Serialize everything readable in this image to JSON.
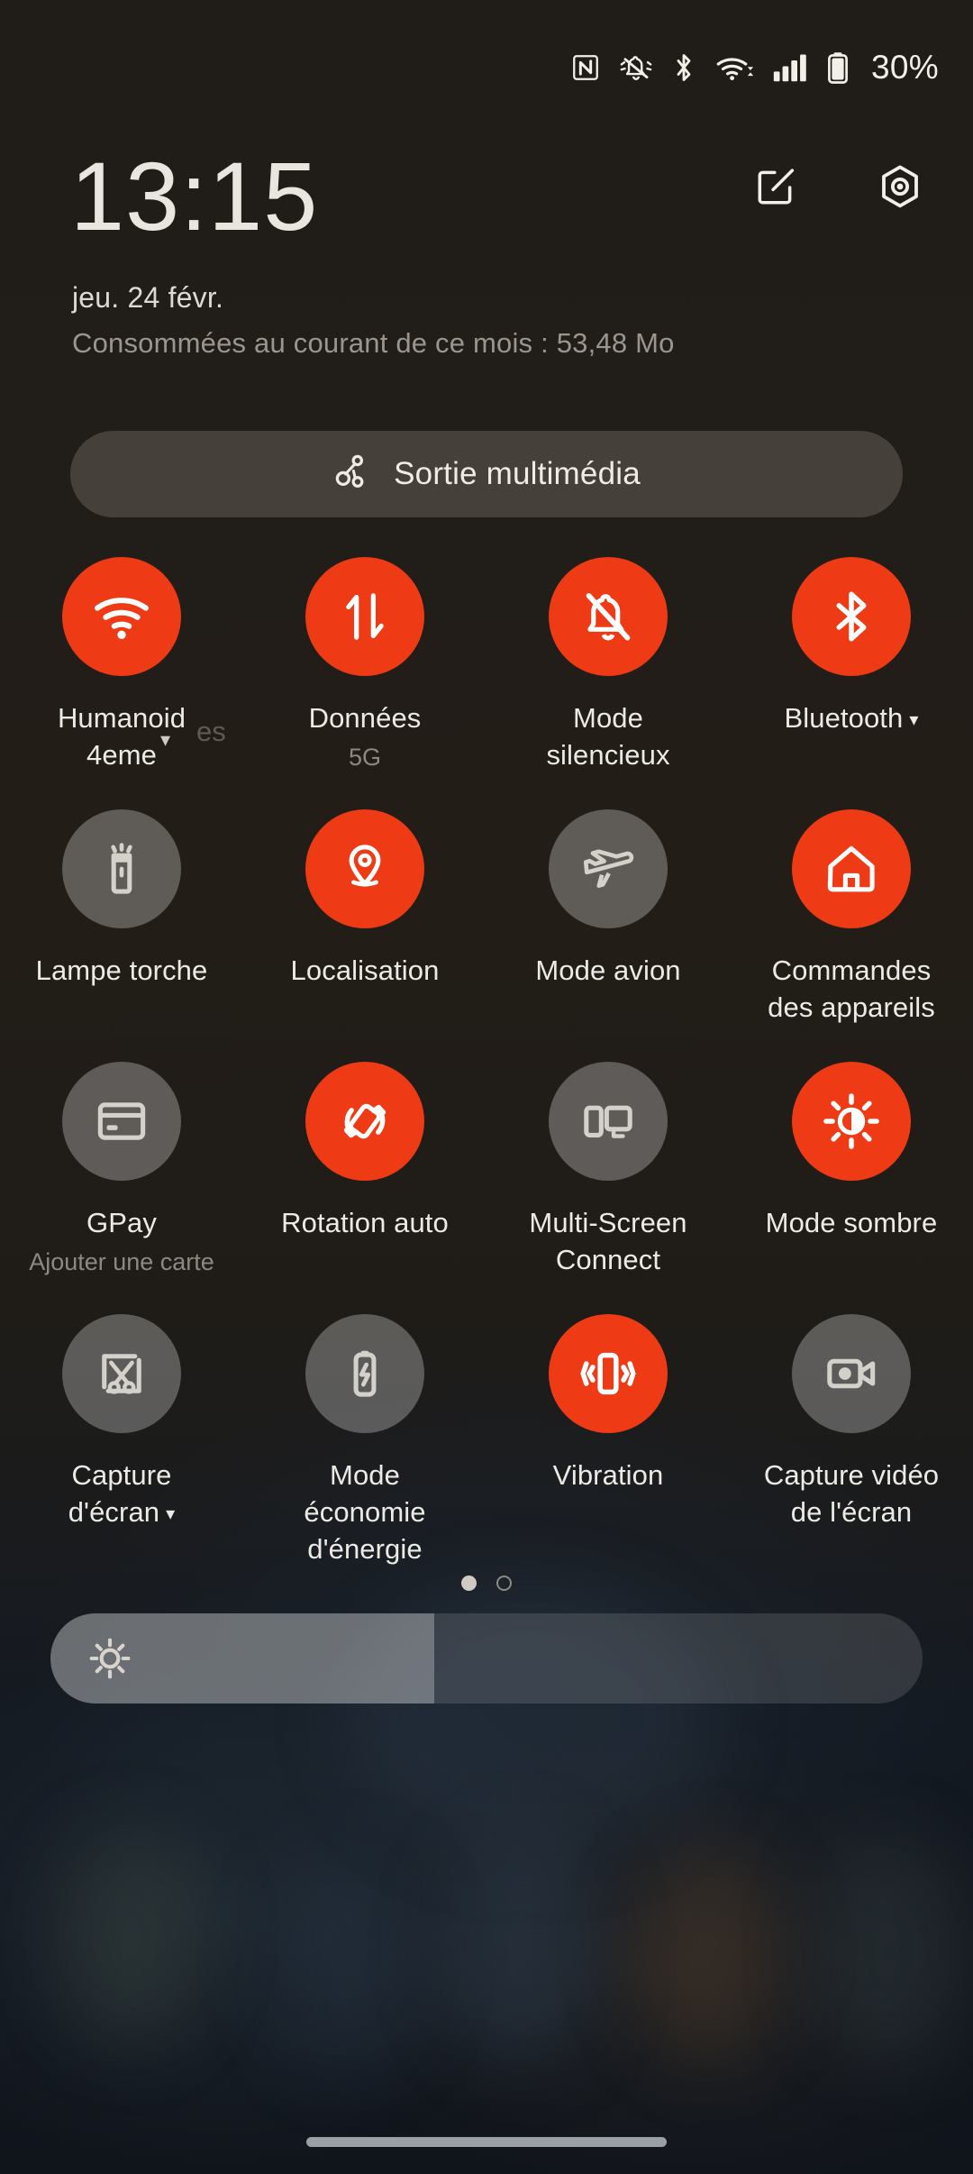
{
  "statusbar": {
    "battery_percent": "30%",
    "icons": [
      "nfc-icon",
      "bell-muted-icon",
      "bluetooth-icon",
      "wifi-icon",
      "signal-bars-icon",
      "battery-icon"
    ]
  },
  "header": {
    "clock": "13:15",
    "date": "jeu. 24 févr.",
    "data_usage": "Consommées au courant de ce mois : 53,48 Mo",
    "edit_icon": "edit-pencil-icon",
    "settings_icon": "settings-hexagon-icon"
  },
  "media_output": {
    "label": "Sortie multimédia",
    "icon": "media-cast-icon"
  },
  "tiles": [
    {
      "label": "Humanoid 4eme",
      "sub": "",
      "state": "on",
      "icon": "wifi-icon",
      "caret": false,
      "float_caret": true,
      "ghost": "es"
    },
    {
      "label": "Données",
      "sub": "5G",
      "state": "on",
      "icon": "data-arrows-icon",
      "caret": false,
      "float_caret": false,
      "ghost": ""
    },
    {
      "label": "Mode silencieux",
      "sub": "",
      "state": "on",
      "icon": "bell-muted-icon",
      "caret": false,
      "float_caret": false,
      "ghost": ""
    },
    {
      "label": "Bluetooth",
      "sub": "",
      "state": "on",
      "icon": "bluetooth-icon",
      "caret": true,
      "float_caret": false,
      "ghost": ""
    },
    {
      "label": "Lampe torche",
      "sub": "",
      "state": "off",
      "icon": "flashlight-icon",
      "caret": false,
      "float_caret": false,
      "ghost": ""
    },
    {
      "label": "Localisation",
      "sub": "",
      "state": "on",
      "icon": "location-pin-icon",
      "caret": false,
      "float_caret": false,
      "ghost": ""
    },
    {
      "label": "Mode avion",
      "sub": "",
      "state": "off",
      "icon": "airplane-icon",
      "caret": false,
      "float_caret": false,
      "ghost": ""
    },
    {
      "label": "Commandes des appareils",
      "sub": "",
      "state": "on",
      "icon": "home-icon",
      "caret": false,
      "float_caret": false,
      "ghost": ""
    },
    {
      "label": "GPay",
      "sub": "Ajouter une carte",
      "state": "off",
      "icon": "credit-card-icon",
      "caret": false,
      "float_caret": false,
      "ghost": ""
    },
    {
      "label": "Rotation auto",
      "sub": "",
      "state": "on",
      "icon": "auto-rotate-icon",
      "caret": false,
      "float_caret": false,
      "ghost": ""
    },
    {
      "label": "Multi-Screen Connect",
      "sub": "",
      "state": "off",
      "icon": "multiscreen-icon",
      "caret": false,
      "float_caret": false,
      "ghost": ""
    },
    {
      "label": "Mode sombre",
      "sub": "",
      "state": "on",
      "icon": "dark-mode-sun-icon",
      "caret": false,
      "float_caret": false,
      "ghost": ""
    },
    {
      "label": "Capture d'écran",
      "sub": "",
      "state": "off",
      "icon": "screenshot-scissors-icon",
      "caret": true,
      "float_caret": false,
      "ghost": ""
    },
    {
      "label": "Mode économie d'énergie",
      "sub": "",
      "state": "off",
      "icon": "battery-saver-icon",
      "caret": false,
      "float_caret": false,
      "ghost": ""
    },
    {
      "label": "Vibration",
      "sub": "",
      "state": "on",
      "icon": "vibration-icon",
      "caret": false,
      "float_caret": false,
      "ghost": ""
    },
    {
      "label": "Capture vidéo de l'écran",
      "sub": "",
      "state": "off",
      "icon": "screen-record-icon",
      "caret": false,
      "float_caret": false,
      "ghost": ""
    }
  ],
  "pager": {
    "page_count": 2,
    "active_page": 1
  },
  "brightness": {
    "percent": 44,
    "icon": "brightness-sun-icon"
  },
  "navbar": {
    "handle": "gesture-home-handle"
  },
  "colors": {
    "tile_on": "#ee3b15",
    "tile_off": "rgba(255,255,255,.28)",
    "text_primary": "#eceae5",
    "text_secondary": "#8d8881",
    "background_top": "#201c18",
    "background_bottom": "#10141b"
  }
}
